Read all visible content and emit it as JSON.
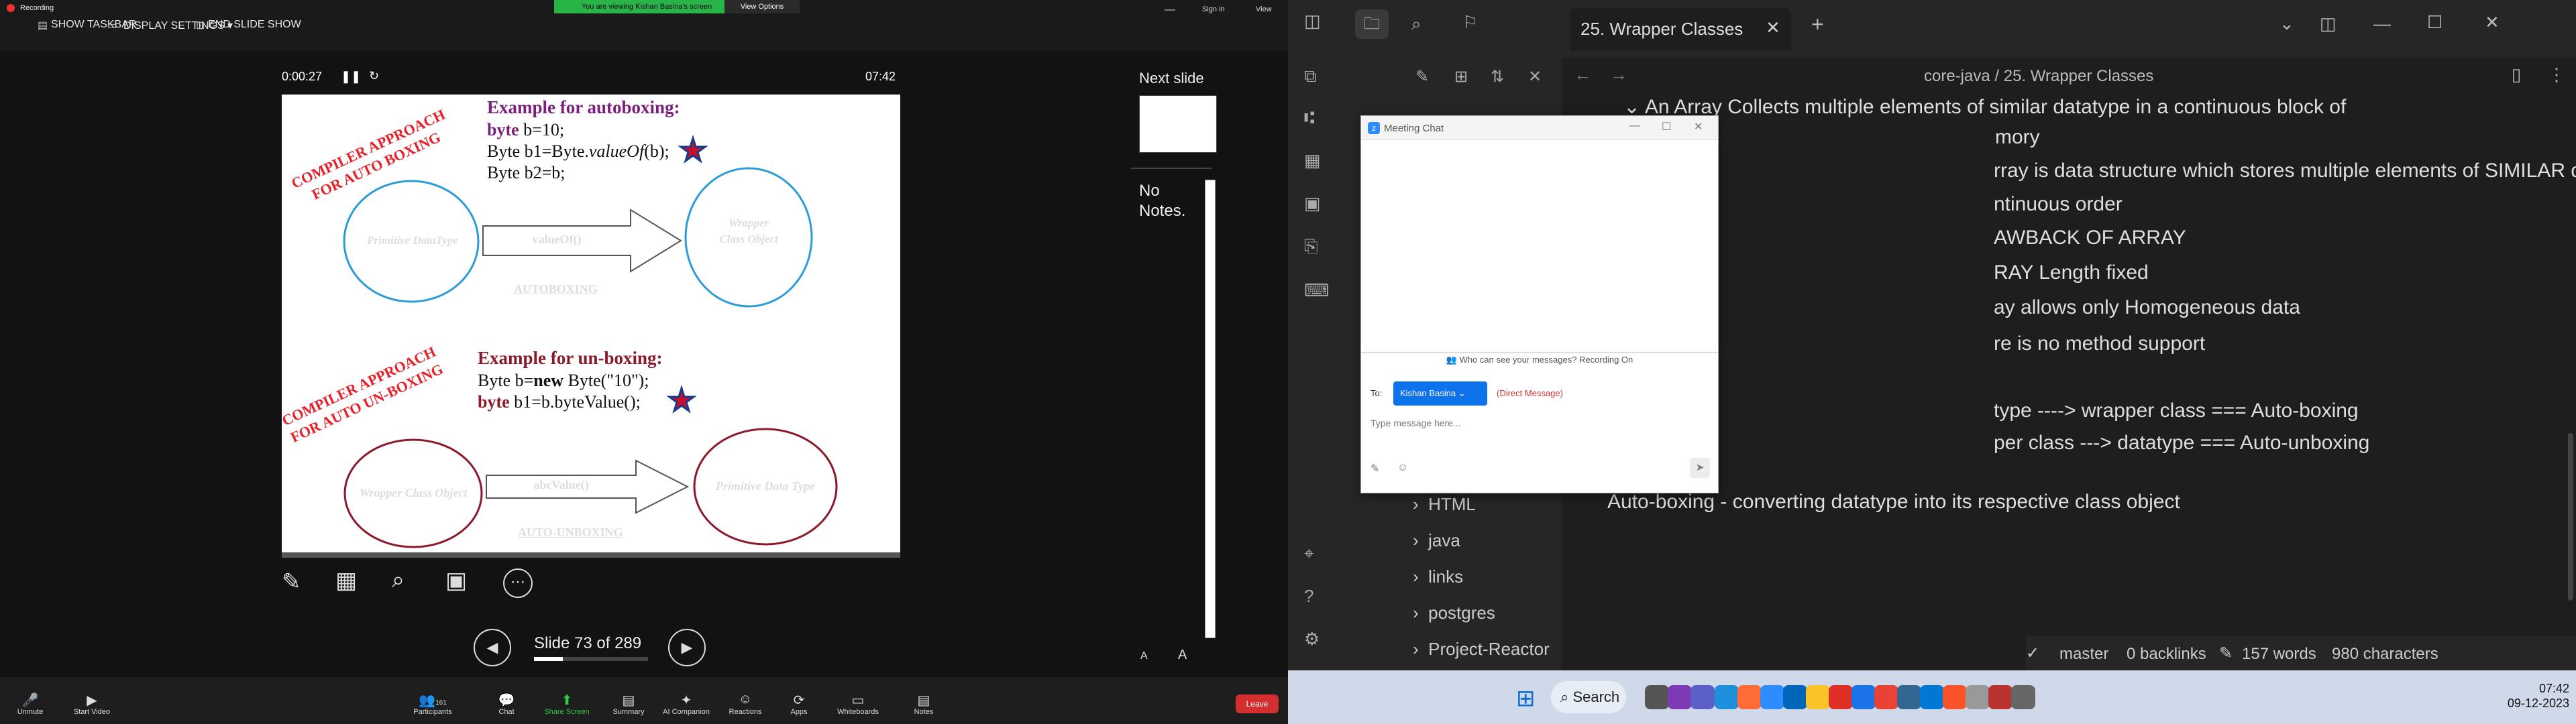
{
  "zoom": {
    "recording": "Recording",
    "show_taskbar": "SHOW TASKBAR",
    "display_settings": "DISPLAY SETTINGS ▾",
    "end_slide_show": "END SLIDE SHOW",
    "banner": "You are viewing Kishan Basina's screen",
    "view_options": "View Options",
    "sign_in": "Sign in",
    "view": "View",
    "elapsed": "0:00:27",
    "duration": "07:42",
    "next_slide": "Next slide",
    "no_notes": "No Notes.",
    "slide_counter": "Slide 73 of 289",
    "font_decrease": "A",
    "font_increase": "A",
    "toolbar": [
      "Unmute",
      "Start Video",
      "Participants",
      "Chat",
      "Share Screen",
      "Summary",
      "AI Companion",
      "Reactions",
      "Apps",
      "Whiteboards",
      "Notes"
    ],
    "participants_count": "161",
    "leave": "Leave"
  },
  "slide": {
    "auto_title": "Example for autoboxing:",
    "auto_line1_kw": "byte",
    "auto_line1_rest": " b=10;",
    "auto_line2": "Byte b1=Byte.",
    "auto_line2_it": "valueOf",
    "auto_line2_end": "(b);",
    "auto_line3": "Byte b2=b;",
    "compiler1a": "COMPILER APPROACH",
    "compiler1b": "FOR AUTO BOXING",
    "prim": "Primitive DataType",
    "valueof": "valueOf()",
    "wrap1": "Wrapper",
    "wrap2": "Class Object",
    "autoboxing": "AUTOBOXING",
    "un_title": "Example for un-boxing:",
    "un_line1a": "Byte b=",
    "un_line1_kw": "new",
    "un_line1_rest": " Byte(\"10\");",
    "un_line2_kw": "byte",
    "un_line2_rest": " b1=b.byteValue();",
    "compiler2a": "COMPILER APPROACH",
    "compiler2b": "FOR AUTO UN-BOXING",
    "wco": "Wrapper Class Object",
    "abc": "abcValue()",
    "pdt": "Primitive Data Type",
    "unboxing": "AUTO-UNBOXING"
  },
  "obsidian": {
    "tab_title": "25. Wrapper Classes",
    "breadcrumb_parent": "core-java",
    "breadcrumb_sep": "/",
    "breadcrumb_current": "25. Wrapper Classes",
    "folders": [
      "HTML",
      "java",
      "links",
      "postgres",
      "Project-Reactor"
    ],
    "lines": [
      "An Array Collects multiple elements of similar datatype in a continuous block of",
      "mory",
      "rray is data structure which stores multiple elements of SIMILAR datatype in",
      "ntinuous order",
      "AWBACK OF ARRAY",
      "RAY Length fixed",
      "ay allows only Homogeneous data",
      "re is no method support",
      "type ----> wrapper class === Auto-boxing",
      "per class ---> datatype ===  Auto-unboxing",
      "Auto-boxing - converting datatype into its respective class object"
    ],
    "status": {
      "branch": "master",
      "backlinks": "0 backlinks",
      "words": "157 words",
      "chars": "980 characters"
    }
  },
  "chat": {
    "title": "Meeting Chat",
    "privacy": "Who can see your messages? Recording On",
    "to_label": "To:",
    "recipient": "Kishan Basina",
    "direct": "(Direct Message)",
    "placeholder": "Type message here..."
  },
  "taskbar": {
    "search": "Search",
    "time": "07:42",
    "date": "09-12-2023"
  }
}
